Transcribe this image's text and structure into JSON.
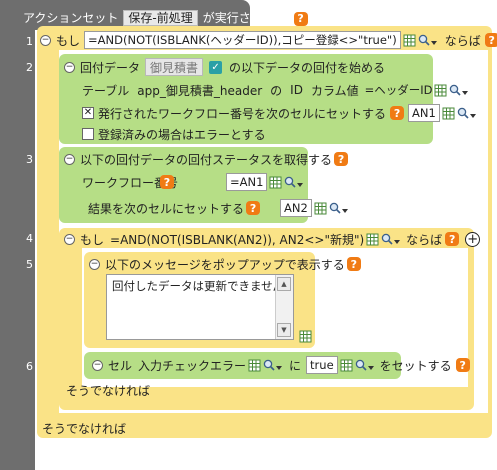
{
  "header": {
    "prefix": "アクションセット",
    "action_set_name": "保存-前処理",
    "suffix": "が実行されたら"
  },
  "line_numbers": [
    "1",
    "2",
    "3",
    "4",
    "5",
    "6"
  ],
  "block1": {
    "if_label": "もし",
    "condition": "=AND(NOT(ISBLANK(ヘッダーID)),コピー登録<>\"true\")",
    "then_label": "ならば"
  },
  "block2": {
    "title": "回付データ",
    "source_field": "御見積書",
    "suffix": "の以下データの回付を始める",
    "table_label": "テーブル",
    "table_name": "app_御見積書_header",
    "of_label": "の",
    "id_label": "ID",
    "column_value_label": "カラム値",
    "column_value": "=ヘッダーID",
    "workflow_number_label": "発行されたワークフロー番号を次のセルにセットする",
    "workflow_number_checked": true,
    "workflow_number_cell": "AN1",
    "error_if_registered_label": "登録済みの場合はエラーとする",
    "error_if_registered_checked": false
  },
  "block3": {
    "title": "以下の回付データの回付ステータスを取得する",
    "workflow_number_label": "ワークフロー番号",
    "workflow_number_value": "=AN1",
    "result_label": "結果を次のセルにセットする",
    "result_cell": "AN2"
  },
  "block4": {
    "if_label": "もし",
    "condition": "=AND(NOT(ISBLANK(AN2)), AN2<>\"新規\")",
    "then_label": "ならば"
  },
  "block5": {
    "title": "以下のメッセージをポップアップで表示する",
    "message": "回付したデータは更新できません。"
  },
  "block6": {
    "cell_label": "セル",
    "cell_name": "入力チェックエラー",
    "to_label": "に",
    "value": "true",
    "set_label": "をセットする"
  },
  "else_inner": "そうでなければ",
  "else_outer": "そうでなければ"
}
